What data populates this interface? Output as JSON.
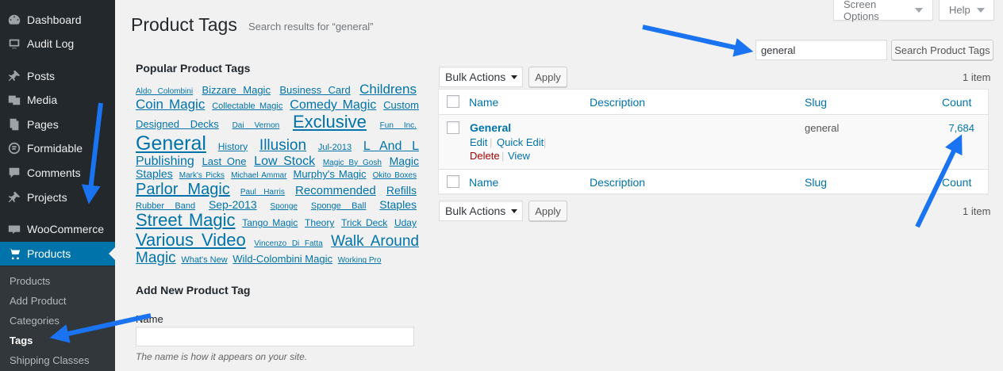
{
  "sidebar": {
    "items": [
      {
        "label": "Dashboard",
        "icon": "dashboard-icon"
      },
      {
        "label": "Audit Log",
        "icon": "audit-log-icon"
      },
      {
        "label": "Posts",
        "icon": "pin-icon"
      },
      {
        "label": "Media",
        "icon": "media-icon"
      },
      {
        "label": "Pages",
        "icon": "pages-icon"
      },
      {
        "label": "Formidable",
        "icon": "formidable-icon"
      },
      {
        "label": "Comments",
        "icon": "comments-icon"
      },
      {
        "label": "Projects",
        "icon": "pin-icon"
      },
      {
        "label": "WooCommerce",
        "icon": "woocommerce-icon"
      },
      {
        "label": "Products",
        "icon": "cart-icon"
      }
    ],
    "submenu": [
      "Products",
      "Add Product",
      "Categories",
      "Tags",
      "Shipping Classes"
    ]
  },
  "top_buttons": {
    "screen_options": "Screen Options",
    "help": "Help"
  },
  "header": {
    "title": "Product Tags",
    "subtitle": "Search results for “general”"
  },
  "popular": {
    "title": "Popular Product Tags",
    "tags": [
      {
        "t": "Aldo Colombini",
        "s": 10
      },
      {
        "t": "Bizzare Magic",
        "s": 13
      },
      {
        "t": "Business Card",
        "s": 13
      },
      {
        "t": "Childrens",
        "s": 17
      },
      {
        "t": "Coin Magic",
        "s": 17
      },
      {
        "t": "Collectable Magic",
        "s": 11
      },
      {
        "t": "Comedy Magic",
        "s": 16
      },
      {
        "t": "Custom Designed Decks",
        "s": 13
      },
      {
        "t": "Dai Vernon",
        "s": 10
      },
      {
        "t": "Exclusive",
        "s": 22
      },
      {
        "t": "Fun Inc.",
        "s": 10
      },
      {
        "t": "General",
        "s": 25
      },
      {
        "t": "History",
        "s": 12
      },
      {
        "t": "Illusion",
        "s": 19
      },
      {
        "t": "Jul-2013",
        "s": 11
      },
      {
        "t": "L And L Publishing",
        "s": 16
      },
      {
        "t": "Last One",
        "s": 13
      },
      {
        "t": "Low Stock",
        "s": 16
      },
      {
        "t": "Magic By Gosh",
        "s": 10
      },
      {
        "t": "Magic Staples",
        "s": 14
      },
      {
        "t": "Mark's Picks",
        "s": 10
      },
      {
        "t": "Michael Ammar",
        "s": 10
      },
      {
        "t": "Murphy's Magic",
        "s": 13
      },
      {
        "t": "Okito Boxes",
        "s": 10
      },
      {
        "t": "Parlor Magic",
        "s": 20
      },
      {
        "t": "Paul Harris",
        "s": 10
      },
      {
        "t": "Recommended",
        "s": 15
      },
      {
        "t": "Refills",
        "s": 14
      },
      {
        "t": "Rubber Band",
        "s": 11
      },
      {
        "t": "Sep-2013",
        "s": 14
      },
      {
        "t": "Sponge",
        "s": 10
      },
      {
        "t": "Sponge Ball",
        "s": 11
      },
      {
        "t": "Staples",
        "s": 14
      },
      {
        "t": "Street Magic",
        "s": 22
      },
      {
        "t": "Tango Magic",
        "s": 12
      },
      {
        "t": "Theory",
        "s": 12
      },
      {
        "t": "Trick Deck",
        "s": 12
      },
      {
        "t": "Uday",
        "s": 12
      },
      {
        "t": "Various Video",
        "s": 22
      },
      {
        "t": "Vincenzo Di Fatta",
        "s": 10
      },
      {
        "t": "Walk Around Magic",
        "s": 19
      },
      {
        "t": "What's New",
        "s": 11
      },
      {
        "t": "Wild-Colombini Magic",
        "s": 13
      },
      {
        "t": "Working Pro",
        "s": 10
      }
    ]
  },
  "add_new": {
    "title": "Add New Product Tag",
    "name_label": "Name",
    "hint": "The name is how it appears on your site."
  },
  "search": {
    "value": "general",
    "button": "Search Product Tags"
  },
  "bulk": {
    "label": "Bulk Actions",
    "apply": "Apply",
    "items": "1 item"
  },
  "table": {
    "headers": {
      "name": "Name",
      "description": "Description",
      "slug": "Slug",
      "count": "Count"
    },
    "row": {
      "name": "General",
      "slug": "general",
      "count": "7,684",
      "edit": "Edit",
      "quick_edit": "Quick Edit",
      "delete": "Delete",
      "view": "View"
    }
  },
  "colors": {
    "accent": "#0073aa",
    "sidebar": "#23282d",
    "arrow": "#1a73f0"
  }
}
